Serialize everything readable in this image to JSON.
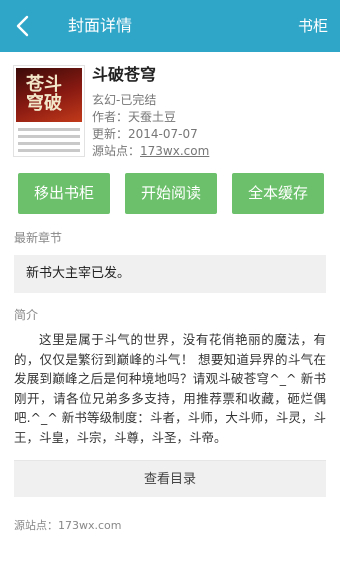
{
  "header": {
    "title": "封面详情",
    "shelf_link": "书柜"
  },
  "book": {
    "title": "斗破苍穹",
    "category": "玄幻-已完结",
    "author": "作者：天蚕土豆",
    "updated": "更新：2014-07-07",
    "source_label": "源站点：",
    "source_link": "173wx.com",
    "cover_text": "斗破苍穹"
  },
  "actions": {
    "remove": "移出书柜",
    "read": "开始阅读",
    "cache": "全本缓存"
  },
  "latest": {
    "label": "最新章节",
    "chapter": "新书大主宰已发。"
  },
  "intro": {
    "label": "简介",
    "text": "这里是属于斗气的世界，没有花俏艳丽的魔法，有的，仅仅是繁衍到巅峰的斗气！ 想要知道异界的斗气在发展到巅峰之后是何种境地吗？请观斗破苍穹^_^ 新书刚开，请各位兄弟多多支持，用推荐票和收藏，砸烂偶吧.^_^ 新书等级制度：斗者，斗师，大斗师，斗灵，斗王，斗皇，斗宗，斗尊，斗圣，斗帝。"
  },
  "catalog_button": "查看目录",
  "footer": {
    "source": "源站点：173wx.com"
  },
  "colors": {
    "header": "#2fa6c8",
    "action_button": "#6cc06b",
    "panel": "#f0f0f0"
  }
}
